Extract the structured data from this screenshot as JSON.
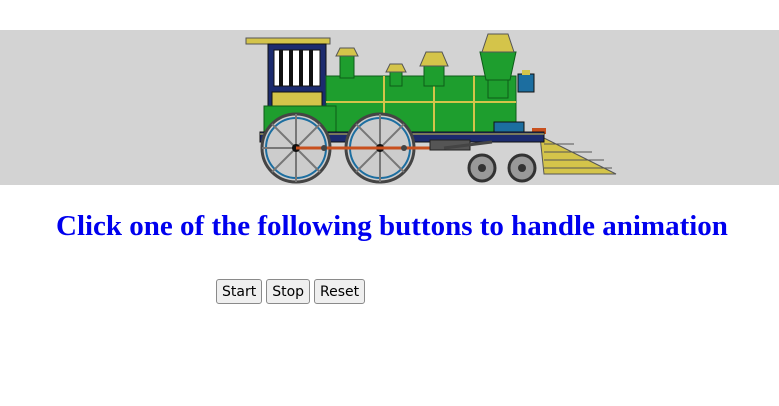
{
  "banner": {
    "image": "steam-locomotive",
    "background": "#d3d3d3",
    "colors": {
      "body": "#1e9e2e",
      "trim": "#d4c44a",
      "frame": "#1c2b6e",
      "wheel": "#8a8a8a",
      "rod": "#c8501e"
    }
  },
  "heading": {
    "text": "Click one of the following buttons to handle animation",
    "color": "#0000ee"
  },
  "controls": {
    "start_label": "Start",
    "stop_label": "Stop",
    "reset_label": "Reset"
  }
}
